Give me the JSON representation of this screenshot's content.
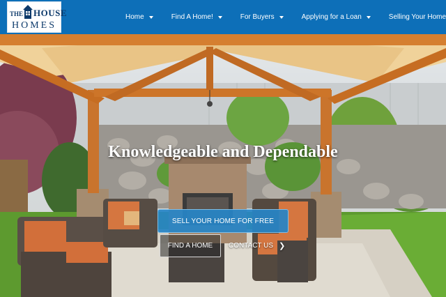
{
  "header": {
    "logo": {
      "prefix": "THE",
      "word": "HOUSE",
      "bottom": "HOMES"
    },
    "nav": [
      {
        "label": "Home",
        "icon": "chevron-down-icon"
      },
      {
        "label": "Find A Home!",
        "icon": "chevron-down-icon"
      },
      {
        "label": "For Buyers",
        "icon": "chevron-down-icon"
      },
      {
        "label": "Applying for a Loan",
        "icon": "chevron-down-icon"
      },
      {
        "label": "Selling Your Home",
        "icon": "chevron-down-icon"
      }
    ]
  },
  "hero": {
    "title": "Knowledgeable and Dependable",
    "primary_button": "SELL YOUR HOME FOR FREE",
    "secondary_button": "FIND A HOME",
    "link": "CONTACT US",
    "link_icon": "chevron-right-icon"
  },
  "colors": {
    "header_bg": "#0d6fb8",
    "primary_button": "#2784c6",
    "logo_text": "#0d3a6b"
  }
}
